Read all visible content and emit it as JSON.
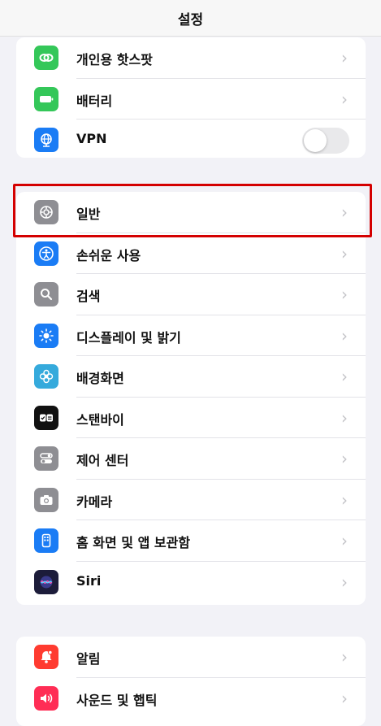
{
  "header": {
    "title": "설정"
  },
  "group_top": [
    {
      "label": "개인용 핫스팟",
      "icon": "hotspot-icon",
      "color": "#34c759"
    },
    {
      "label": "배터리",
      "icon": "battery-icon",
      "color": "#34c759"
    },
    {
      "label": "VPN",
      "icon": "vpn-globe-icon",
      "color": "#1a7cf5",
      "toggle": false
    }
  ],
  "group_main": [
    {
      "label": "일반",
      "icon": "gear-icon",
      "color": "#8e8e93"
    },
    {
      "label": "손쉬운 사용",
      "icon": "accessibility-icon",
      "color": "#1a7cf5"
    },
    {
      "label": "검색",
      "icon": "search-icon",
      "color": "#8e8e93"
    },
    {
      "label": "디스플레이 및 밝기",
      "icon": "brightness-icon",
      "color": "#1a7cf5"
    },
    {
      "label": "배경화면",
      "icon": "wallpaper-flower-icon",
      "color": "#35aadc"
    },
    {
      "label": "스탠바이",
      "icon": "standby-icon",
      "color": "#111111"
    },
    {
      "label": "제어 센터",
      "icon": "control-center-icon",
      "color": "#8e8e93"
    },
    {
      "label": "카메라",
      "icon": "camera-icon",
      "color": "#8e8e93"
    },
    {
      "label": "홈 화면 및 앱 보관함",
      "icon": "home-screen-icon",
      "color": "#1a7cf5"
    },
    {
      "label": "Siri",
      "icon": "siri-icon",
      "color": "#3a3a8c"
    }
  ],
  "group_bottom": [
    {
      "label": "알림",
      "icon": "notifications-icon",
      "color": "#ff3b30"
    },
    {
      "label": "사운드 및 햅틱",
      "icon": "sound-icon",
      "color": "#ff2d55"
    }
  ],
  "chevron": "›"
}
